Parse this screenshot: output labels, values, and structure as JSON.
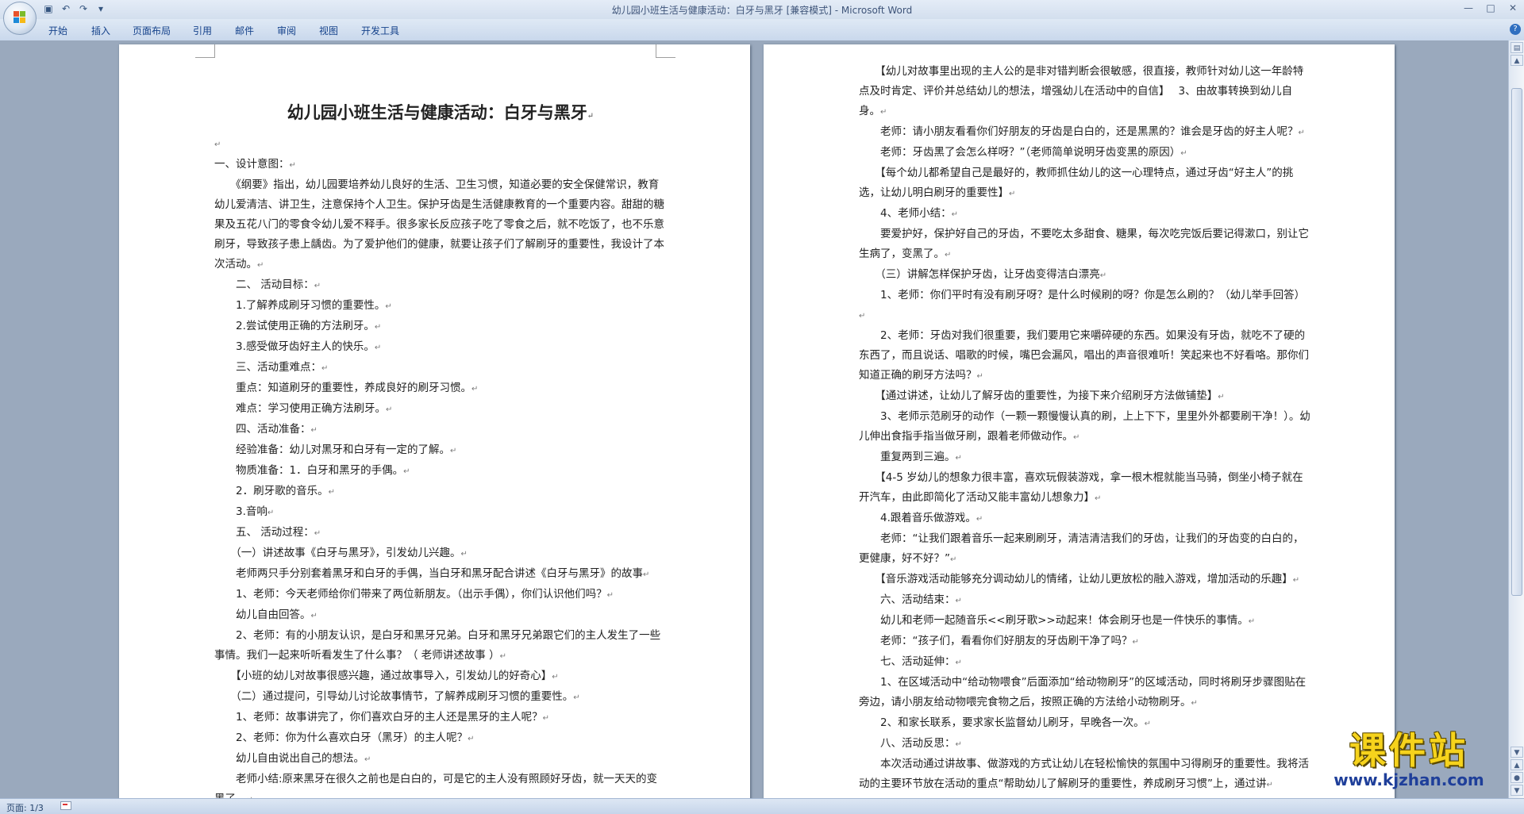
{
  "window": {
    "title": "幼儿园小班生活与健康活动：白牙与黑牙 [兼容模式] - Microsoft Word"
  },
  "quick_access": {
    "save_icon": "save-icon",
    "undo_icon": "undo-icon",
    "redo_icon": "redo-icon",
    "customize_icon": "dropdown-icon"
  },
  "ribbon": {
    "tabs": [
      "开始",
      "插入",
      "页面布局",
      "引用",
      "邮件",
      "审阅",
      "视图",
      "开发工具"
    ]
  },
  "document": {
    "title": "幼儿园小班生活与健康活动：白牙与黑牙",
    "page1_paragraphs": [
      "",
      "一、设计意图：",
      "　　《纲要》指出，幼儿园要培养幼儿良好的生活、卫生习惯，知道必要的安全保健常识，教育幼儿爱清洁、讲卫生，注意保持个人卫生。保护牙齿是生活健康教育的一个重要内容。甜甜的糖果及五花八门的零食令幼儿爱不释手。很多家长反应孩子吃了零食之后，就不吃饭了，也不乐意刷牙，导致孩子患上龋齿。为了爱护他们的健康，就要让孩子们了解刷牙的重要性，我设计了本次活动。",
      "　　二、 活动目标：",
      "　　1.了解养成刷牙习惯的重要性。",
      "　　2.尝试使用正确的方法刷牙。",
      "　　3.感受做牙齿好主人的快乐。",
      "　　三、活动重难点：",
      "　　重点：知道刷牙的重要性，养成良好的刷牙习惯。",
      "　　难点：学习使用正确方法刷牙。",
      "　　四、活动准备：",
      "　　经验准备：幼儿对黑牙和白牙有一定的了解。",
      "　　物质准备：1．白牙和黑牙的手偶。",
      "　　2．刷牙歌的音乐。",
      "　　3.音响",
      "　　五、 活动过程：",
      "　　（一）讲述故事《白牙与黑牙》，引发幼儿兴趣。",
      "　　老师两只手分别套着黑牙和白牙的手偶，当白牙和黑牙配合讲述《白牙与黑牙》的故事",
      "　　1、老师：今天老师给你们带来了两位新朋友。（出示手偶），你们认识他们吗？",
      "　　幼儿自由回答。",
      "　　2、老师：有的小朋友认识，是白牙和黑牙兄弟。白牙和黑牙兄弟跟它们的主人发生了一些事情。我们一起来听听看发生了什么事？（ 老师讲述故事 ）",
      "　　【小班的幼儿对故事很感兴趣，通过故事导入，引发幼儿的好奇心】",
      "　　（二）通过提问，引导幼儿讨论故事情节，了解养成刷牙习惯的重要性。",
      "　　1、老师：故事讲完了，你们喜欢白牙的主人还是黑牙的主人呢？",
      "　　2、老师：你为什么喜欢白牙（黑牙）的主人呢？",
      "　　幼儿自由说出自己的想法。",
      "　　老师小结:原来黑牙在很久之前也是白白的，可是它的主人没有照顾好牙齿，就一天天的变黑了。"
    ],
    "page2_paragraphs": [
      "　　【幼儿对故事里出现的主人公的是非对错判断会很敏感，很直接，教师针对幼儿这一年龄特点及时肯定、评价并总结幼儿的想法，增强幼儿在活动中的自信】　 3、由故事转换到幼儿自身。",
      "　　老师：请小朋友看看你们好朋友的牙齿是白白的，还是黑黑的？谁会是牙齿的好主人呢？",
      "　　老师：牙齿黑了会怎么样呀？”（老师简单说明牙齿变黑的原因）",
      "　　【每个幼儿都希望自己是最好的，教师抓住幼儿的这一心理特点，通过牙齿“好主人”的挑选，让幼儿明白刷牙的重要性】",
      "　　4、老师小结：",
      "　　要爱护好，保护好自己的牙齿，不要吃太多甜食、糖果，每次吃完饭后要记得漱口，别让它生病了，变黑了。",
      "　　（三）讲解怎样保护牙齿，让牙齿变得洁白漂亮",
      "　　1、老师：你们平时有没有刷牙呀？是什么时候刷的呀？你是怎么刷的？（幼儿举手回答）",
      "　　2、老师：牙齿对我们很重要，我们要用它来嚼碎硬的东西。如果没有牙齿，就吃不了硬的东西了，而且说话、唱歌的时候，嘴巴会漏风，唱出的声音很难听！笑起来也不好看咯。那你们知道正确的刷牙方法吗？",
      "　　【通过讲述，让幼儿了解牙齿的重要性，为接下来介绍刷牙方法做铺垫】",
      "　　3、老师示范刷牙的动作（一颗一颗慢慢认真的刷，上上下下，里里外外都要刷干净！）。幼儿伸出食指手指当做牙刷，跟着老师做动作。",
      "　　重复两到三遍。",
      "　　【4-5 岁幼儿的想象力很丰富，喜欢玩假装游戏，拿一根木棍就能当马骑，倒坐小椅子就在开汽车，由此即简化了活动又能丰富幼儿想象力】",
      "　　4.跟着音乐做游戏。",
      "　　老师：“让我们跟着音乐一起来刷刷牙，清洁清洁我们的牙齿，让我们的牙齿变的白白的，更健康，好不好？”",
      "　　【音乐游戏活动能够充分调动幼儿的情绪，让幼儿更放松的融入游戏，增加活动的乐趣】",
      "　　六、活动结束：",
      "　　幼儿和老师一起随音乐<<刷牙歌>>动起来！体会刷牙也是一件快乐的事情。",
      "　　老师：“孩子们，看看你们好朋友的牙齿刷干净了吗？",
      "　　七、活动延伸：",
      "　　1、在区域活动中“给动物喂食”后面添加“给动物刷牙”的区域活动，同时将刷牙步骤图贴在旁边，请小朋友给动物喂完食物之后，按照正确的方法给小动物刷牙。",
      "　　2、和家长联系，要求家长监督幼儿刷牙，早晚各一次。",
      "　　八、活动反思：",
      "　　本次活动通过讲故事、做游戏的方式让幼儿在轻松愉快的氛围中习得刷牙的重要性。我将活动的主要环节放在活动的重点“帮助幼儿了解刷牙的重要性，养成刷牙习惯”上，通过讲"
    ]
  },
  "statusbar": {
    "page": "页面: 1/3"
  },
  "watermark": {
    "name": "课件站",
    "url": "www.kjzhan.com"
  },
  "colors": {
    "ribbon_text": "#15428b",
    "workspace": "#9aa9bd",
    "watermark_yellow": "#f6d31c",
    "watermark_blue": "#1f3f9a"
  }
}
